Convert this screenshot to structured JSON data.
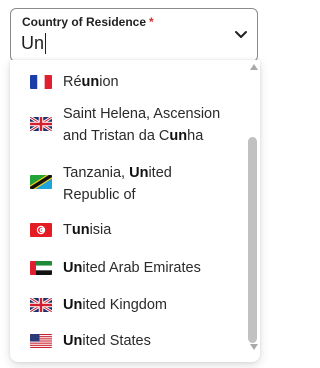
{
  "field": {
    "label": "Country of Residence",
    "required_mark": "*",
    "value": "Un"
  },
  "options": [
    {
      "name": "Réunion",
      "parts": [
        "Ré",
        "un",
        "ion"
      ],
      "flag": "france-flag-icon"
    },
    {
      "line1_parts": [
        "Saint Helena, Ascension",
        "",
        ""
      ],
      "line2_parts": [
        "and Tristan da C",
        "un",
        "ha"
      ],
      "flag": "uk-flag-icon"
    },
    {
      "line1_parts": [
        "Tanzania, ",
        "Un",
        "ited"
      ],
      "line2": "Republic of",
      "flag": "tanzania-flag-icon"
    },
    {
      "parts": [
        "T",
        "un",
        "isia"
      ],
      "flag": "tunisia-flag-icon"
    },
    {
      "parts": [
        "",
        "Un",
        "ited Arab Emirates"
      ],
      "flag": "uae-flag-icon"
    },
    {
      "parts": [
        "",
        "Un",
        "ited Kingdom"
      ],
      "flag": "uk-flag-icon"
    },
    {
      "parts": [
        "",
        "Un",
        "ited States"
      ],
      "flag": "us-flag-icon"
    }
  ],
  "colors": {
    "required": "#d32f2f",
    "border": "#8b8b8b",
    "scroll_thumb": "#c1c1c1"
  }
}
